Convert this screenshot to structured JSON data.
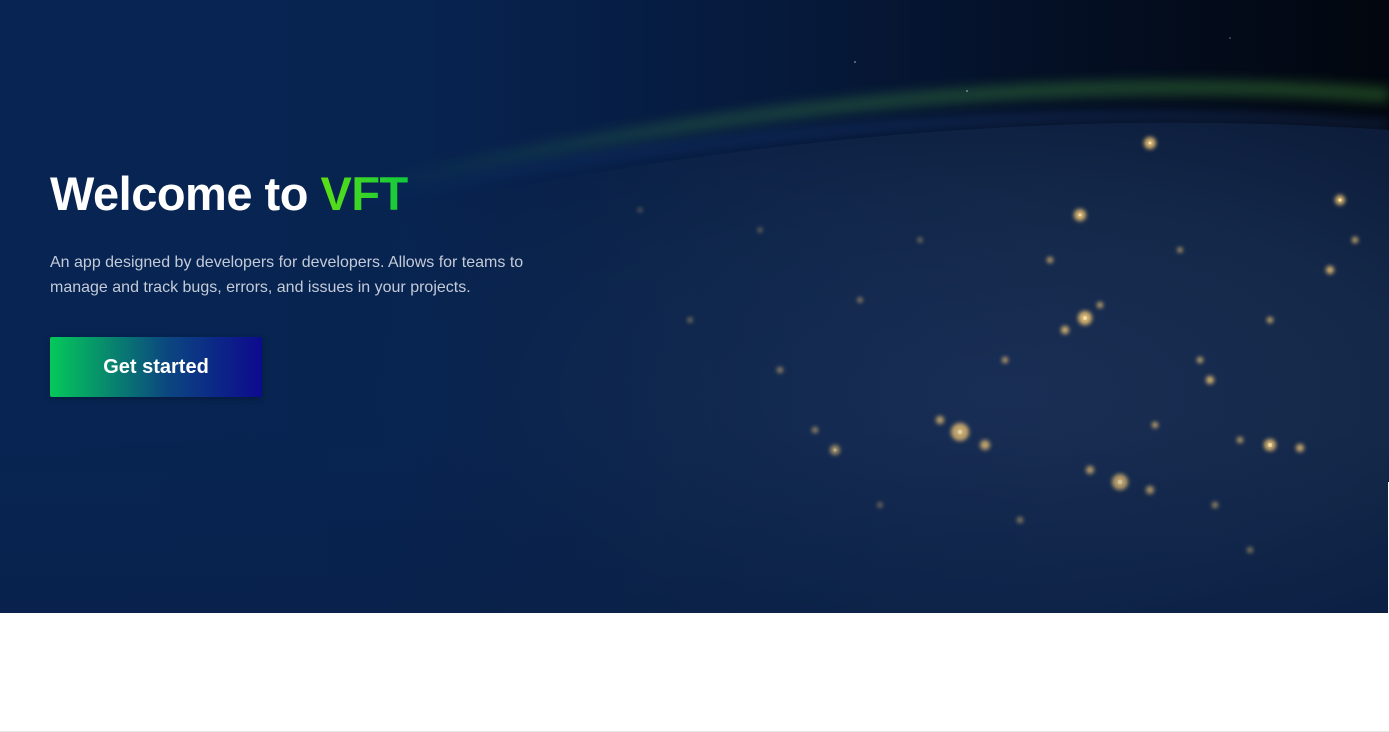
{
  "hero": {
    "title_prefix": "Welcome to ",
    "title_brand": "VFT",
    "subtitle": "An app designed by developers for developers. Allows for teams to manage and track bugs, errors, and issues in your projects.",
    "cta_label": "Get started",
    "background_image": "night-earth-from-space",
    "colors": {
      "overlay": "#0a2149",
      "brand_green": "#22d12a",
      "cta_gradient_start": "#04c95a",
      "cta_gradient_end": "#0d0a8e"
    }
  }
}
